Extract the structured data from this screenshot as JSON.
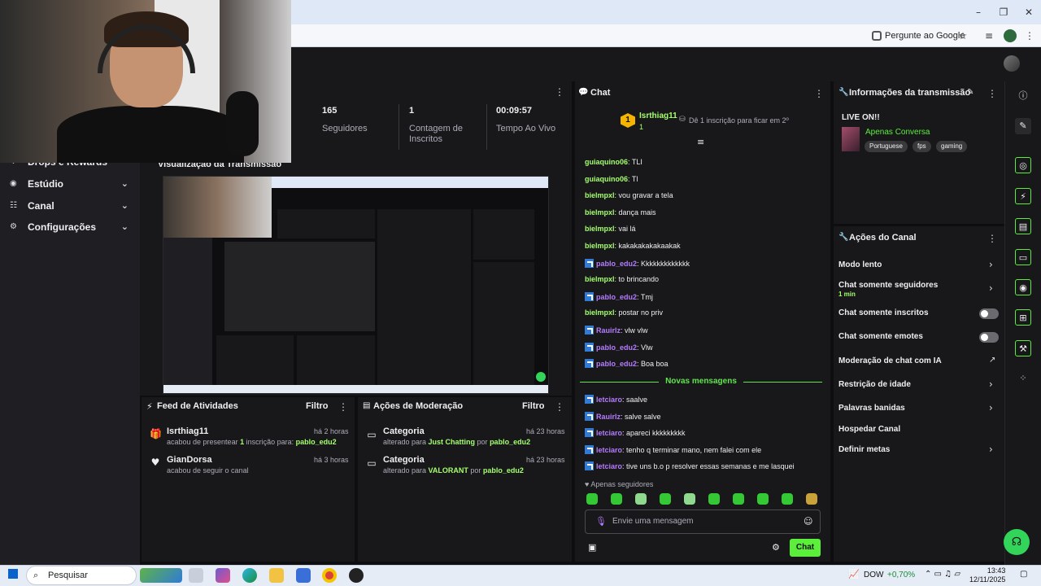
{
  "browser": {
    "ask_google": "Pergunte ao Google"
  },
  "sidebar": {
    "items": [
      {
        "label": "Drops e Rewards"
      },
      {
        "label": "Estúdio"
      },
      {
        "label": "Canal"
      },
      {
        "label": "Configurações"
      }
    ]
  },
  "stats": {
    "followers_value": "165",
    "followers_label": "Seguidores",
    "subs_value": "1",
    "subs_label": "Contagem de Inscritos",
    "live_value": "00:09:57",
    "live_label": "Tempo Ao Vivo"
  },
  "preview": {
    "title": "Visualização da Transmissão"
  },
  "feed": {
    "title": "Feed de Atividades",
    "filter": "Filtro",
    "items": [
      {
        "name": "Isrthiag11",
        "desc_pre": "acabou de presentear ",
        "desc_num": "1",
        "desc_mid": " inscrição para: ",
        "desc_user": "pablo_edu2",
        "time": "há 2 horas"
      },
      {
        "name": "GianDorsa",
        "desc": "acabou de seguir o canal",
        "time": "há 3 horas"
      }
    ]
  },
  "moderation": {
    "title": "Ações de Moderação",
    "filter": "Filtro",
    "items": [
      {
        "name": "Categoria",
        "pre": "alterado para ",
        "value": "Just Chatting",
        "mid": " por ",
        "user": "pablo_edu2",
        "time": "há 23 horas"
      },
      {
        "name": "Categoria",
        "pre": "alterado para ",
        "value": "VALORANT",
        "mid": " por ",
        "user": "pablo_edu2",
        "time": "há 23 horas"
      }
    ]
  },
  "chat": {
    "title": "Chat",
    "top_user": "Isrthiag11",
    "top_count": "1",
    "gift_prompt": "Dê 1 inscrição para ficar em 2º",
    "messages": [
      {
        "user": "guiaquino06",
        "text": "TLI",
        "color": "green",
        "badge": false
      },
      {
        "user": "guiaquino06",
        "text": "Tl",
        "color": "green",
        "badge": false
      },
      {
        "user": "bielmpxl",
        "text": "vou gravar a tela",
        "color": "green",
        "badge": false
      },
      {
        "user": "bielmpxl",
        "text": "dança mais",
        "color": "green",
        "badge": false
      },
      {
        "user": "bielmpxl",
        "text": "vai lá",
        "color": "green",
        "badge": false
      },
      {
        "user": "bielmpxl",
        "text": "kakakakakakaakak",
        "color": "green",
        "badge": false
      },
      {
        "user": "pablo_edu2",
        "text": "Kkkkkkkkkkkkk",
        "color": "purple",
        "badge": true
      },
      {
        "user": "bielmpxl",
        "text": "to brincando",
        "color": "green",
        "badge": false
      },
      {
        "user": "pablo_edu2",
        "text": "Tmj",
        "color": "purple",
        "badge": true
      },
      {
        "user": "bielmpxl",
        "text": "postar no priv",
        "color": "green",
        "badge": false
      },
      {
        "user": "Rauirlz",
        "text": "vlw vlw",
        "color": "purple",
        "badge": true
      },
      {
        "user": "pablo_edu2",
        "text": "Vlw",
        "color": "purple",
        "badge": true
      },
      {
        "user": "pablo_edu2",
        "text": "Boa boa",
        "color": "purple",
        "badge": true
      }
    ],
    "new_messages_label": "Novas mensagens",
    "new_messages": [
      {
        "user": "letciaro",
        "text": "saalve",
        "color": "purple",
        "badge": true
      },
      {
        "user": "Rauirlz",
        "text": "salve salve",
        "color": "purple",
        "badge": true
      },
      {
        "user": "letciaro",
        "text": "apareci kkkkkkkkk",
        "color": "purple",
        "badge": true
      },
      {
        "user": "letciaro",
        "text": "tenho q terminar mano, nem falei com ele",
        "color": "purple",
        "badge": true
      },
      {
        "user": "letciaro",
        "text": "tive uns b.o p resolver essas semanas e me lasquei",
        "color": "purple",
        "badge": true
      }
    ],
    "followers_only": "Apenas seguidores",
    "input_placeholder": "Envie uma mensagem",
    "send_label": "Chat"
  },
  "info": {
    "title": "Informações da transmissão",
    "status": "LIVE ON!!",
    "category": "Apenas Conversa",
    "tags": [
      "Portuguese",
      "fps",
      "gaming"
    ]
  },
  "actions": {
    "title": "Ações do Canal",
    "items": [
      {
        "label": "Modo lento",
        "kind": "chevron"
      },
      {
        "label": "Chat somente seguidores",
        "sub": "1 min",
        "kind": "chevron"
      },
      {
        "label": "Chat somente inscritos",
        "kind": "toggle"
      },
      {
        "label": "Chat somente emotes",
        "kind": "toggle"
      },
      {
        "label": "Moderação de chat com IA",
        "kind": "external"
      },
      {
        "label": "Restrição de idade",
        "kind": "chevron"
      },
      {
        "label": "Palavras banidas",
        "kind": "chevron"
      },
      {
        "label": "Hospedar Canal",
        "kind": "none"
      },
      {
        "label": "Definir metas",
        "kind": "chevron"
      }
    ]
  },
  "taskbar": {
    "search": "Pesquisar",
    "ticker": "DOW",
    "ticker_change": "+0,70%",
    "time": "13:43",
    "date": "12/11/2025"
  },
  "colors": {
    "accent": "#5bef3c",
    "username_green": "#a5ff6b",
    "username_purple": "#b57cff",
    "panel_bg": "#18181b",
    "page_bg": "#0e0e10"
  }
}
